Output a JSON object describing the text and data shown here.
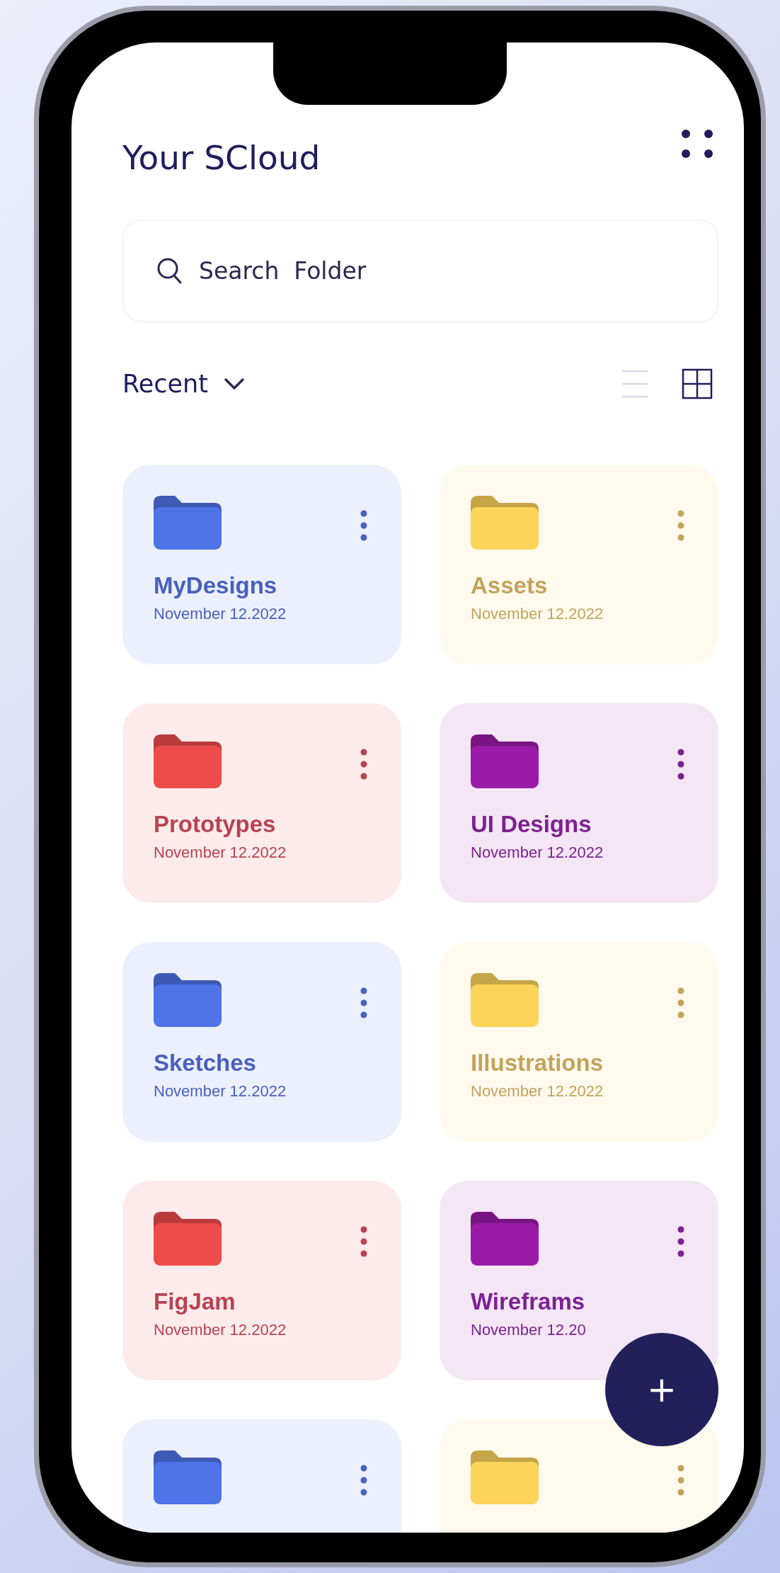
{
  "header": {
    "title": "Your SCloud"
  },
  "search": {
    "placeholder": "Search  Folder"
  },
  "filter": {
    "label": "Recent"
  },
  "view_modes": [
    {
      "kind": "list",
      "selected": false
    },
    {
      "kind": "grid",
      "selected": true
    }
  ],
  "folders": [
    {
      "name": "MyDesigns",
      "date": "November 12.2022",
      "color": "#4f74e8"
    },
    {
      "name": "Assets",
      "date": "November 12.2022",
      "color": "#fdd45a"
    },
    {
      "name": "Prototypes",
      "date": "November 12.2022",
      "color": "#ee4b4b"
    },
    {
      "name": "UI Designs",
      "date": "November 12.2022",
      "color": "#9a1ba8"
    },
    {
      "name": "Sketches",
      "date": "November 12.2022",
      "color": "#4f74e8"
    },
    {
      "name": "Illustrations",
      "date": "November 12.2022",
      "color": "#fdd45a"
    },
    {
      "name": "FigJam",
      "date": "November 12.2022",
      "color": "#ee4b4b"
    },
    {
      "name": "Wireframs",
      "date": "November 12.20",
      "color": "#9a1ba8"
    },
    {
      "color": "#4f74e8"
    },
    {
      "color": "#fdd45a"
    }
  ],
  "fab": {
    "label": "+"
  }
}
